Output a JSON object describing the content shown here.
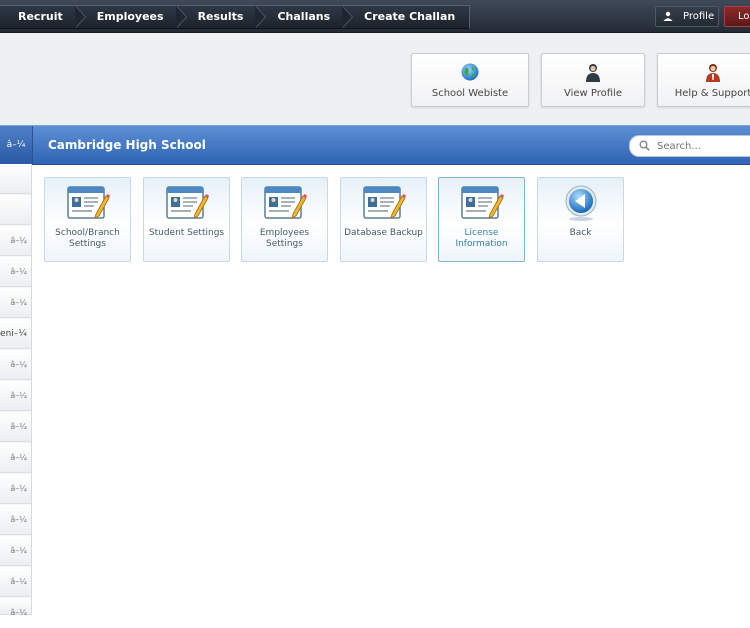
{
  "topnav": {
    "breadcrumbs": [
      "Recruit",
      "Employees",
      "Results",
      "Challans",
      "Create Challan"
    ],
    "profile_label": "Profile",
    "logout_label": "Log"
  },
  "header": {
    "tiles": [
      {
        "label": "School Webiste",
        "icon": "globe-icon"
      },
      {
        "label": "View Profile",
        "icon": "user-icon"
      },
      {
        "label": "Help & Support",
        "icon": "support-user-icon"
      }
    ]
  },
  "bluebar": {
    "side_label": "â–¼",
    "school_name": "Cambridge High School",
    "search_placeholder": "Search..."
  },
  "sidebar": {
    "items": [
      "",
      "",
      "â–¼",
      "â–¼",
      "â–¼",
      "eni–¼",
      "â–¼",
      "â–¼",
      "â–¼",
      "â–¼",
      "â–¼",
      "â–¼",
      "â–¼",
      "â–¼",
      "â–¼"
    ]
  },
  "settings": {
    "tiles": [
      {
        "label": "School/Branch Settings",
        "icon": "id-card-pencil-icon"
      },
      {
        "label": "Student Settings",
        "icon": "id-card-pencil-icon"
      },
      {
        "label": "Employees Settings",
        "icon": "id-card-pencil-icon"
      },
      {
        "label": "Database Backup",
        "icon": "id-card-pencil-icon"
      },
      {
        "label": "License Information",
        "icon": "id-card-pencil-icon"
      },
      {
        "label": "Back",
        "icon": "back-arrow-icon"
      }
    ]
  },
  "colors": {
    "topbar": "#2b3440",
    "bluebar": "#3f74c2",
    "tile_border": "#c5d9e8"
  }
}
